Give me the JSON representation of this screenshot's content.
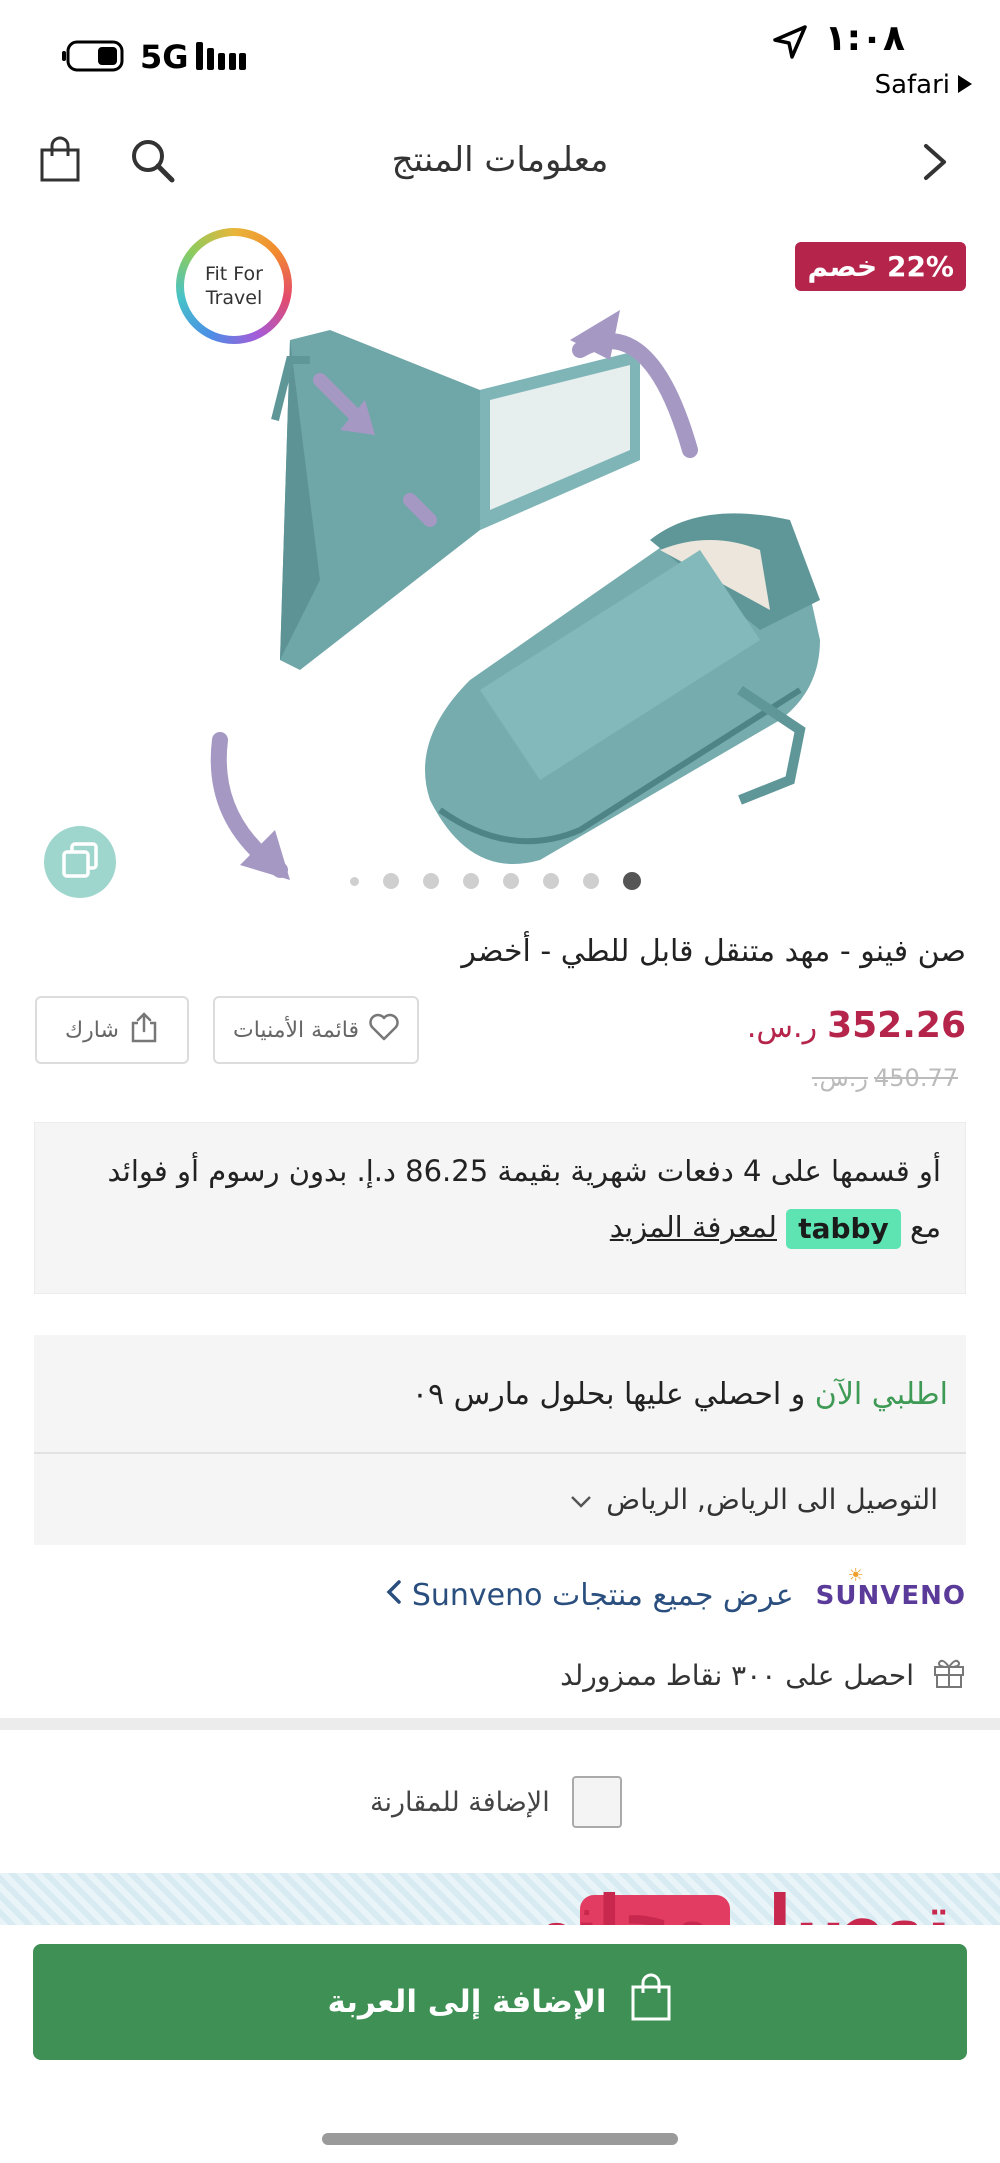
{
  "status_bar": {
    "time": "١:٠٨",
    "network": "5G",
    "back_app": "Safari"
  },
  "header": {
    "title": "معلومات المنتج"
  },
  "product": {
    "discount_badge": "22% خصم",
    "fit_badge_line1": "Fit For",
    "fit_badge_line2": "Travel",
    "image_count": 8,
    "active_image_index": 7,
    "title": "صن فينو - مهد متنقل قابل للطي - أخضر",
    "price": "352.26",
    "currency": "ر.س.",
    "old_price": "450.77",
    "old_currency": "ر.س."
  },
  "actions": {
    "wishlist_label": "قائمة الأمنيات",
    "share_label": "شارك"
  },
  "tabby": {
    "text_before": "أو قسمها على 4 دفعات شهرية بقيمة 86.25 د.إ. بدون رسوم أو فوائد",
    "with_label": "مع",
    "logo": "tabby",
    "learn_more": "لمعرفة المزيد"
  },
  "delivery": {
    "order_now": "اطلبي الآن",
    "connector": "و احصلي عليها بحلول",
    "date": "مارس ٠٩",
    "deliver_to": "التوصيل الى الرياض, الرياض"
  },
  "brand": {
    "logo": "SUNVENO",
    "view_all": "عرض جميع منتجات Sunveno"
  },
  "points": {
    "text": "احصل على ٣٠٠ نقاط ممزورلد"
  },
  "compare": {
    "label": "الإضافة للمقارنة",
    "checked": false
  },
  "promo": {
    "text": "توصيل مجاني"
  },
  "cart": {
    "label": "الإضافة إلى العربة"
  },
  "colors": {
    "accent_green": "#3e9055",
    "price_red": "#b5244a",
    "tabby_green": "#5ee3b2",
    "brand_link": "#2a4f7f"
  }
}
